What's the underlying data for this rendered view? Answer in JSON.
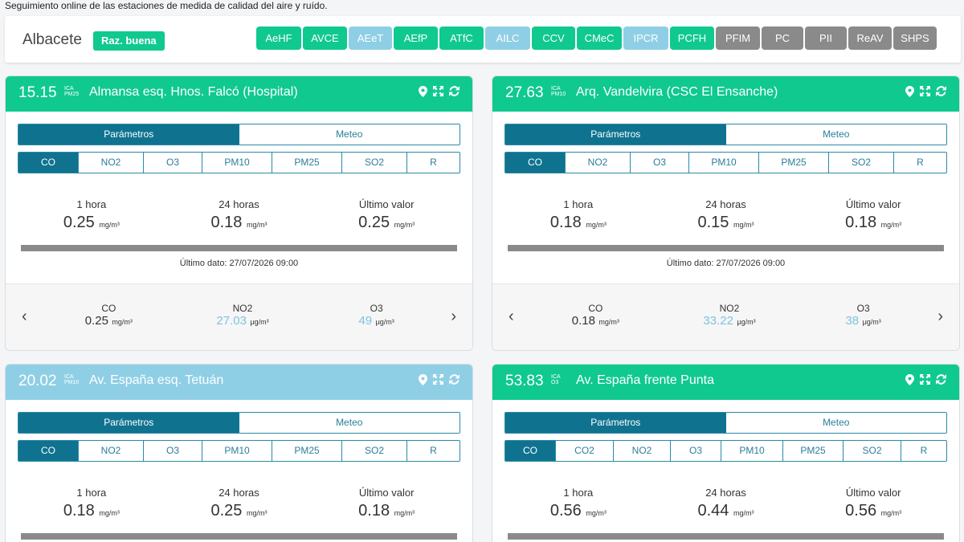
{
  "page": {
    "subtitle": "Seguimiento online de las estaciones de medida de calidad del aire y ruído."
  },
  "header": {
    "city": "Albacete",
    "city_quality": "Raz. buena",
    "stations": [
      {
        "code": "AeHF",
        "status": "good"
      },
      {
        "code": "AVCE",
        "status": "good"
      },
      {
        "code": "AEeT",
        "status": "fair"
      },
      {
        "code": "AEfP",
        "status": "good"
      },
      {
        "code": "ATfC",
        "status": "good"
      },
      {
        "code": "AILC",
        "status": "fair"
      },
      {
        "code": "CCV",
        "status": "good"
      },
      {
        "code": "CMeC",
        "status": "good"
      },
      {
        "code": "IPCR",
        "status": "fair"
      },
      {
        "code": "PCFH",
        "status": "good"
      },
      {
        "code": "PFIM",
        "status": "none"
      },
      {
        "code": "PC",
        "status": "none"
      },
      {
        "code": "PII",
        "status": "none"
      },
      {
        "code": "ReAV",
        "status": "none"
      },
      {
        "code": "SHPS",
        "status": "none"
      }
    ]
  },
  "colors": {
    "good": "#10c98f",
    "fair": "#8fcfe5",
    "none": "#8a8a8a",
    "primary": "#0f7390"
  },
  "icons": [
    "map-marker-icon",
    "expand-icon",
    "refresh-icon",
    "chevron-left-icon",
    "chevron-right-icon"
  ],
  "cards": [
    {
      "ica_value": "15.15",
      "ica_label": "ICA",
      "ica_pollutant": "PM25",
      "status": "good",
      "station_name": "Almansa esq. Hnos. Falcó (Hospital)",
      "tabs": [
        "Parámetros",
        "Meteo"
      ],
      "params": [
        "CO",
        "NO2",
        "O3",
        "PM10",
        "PM25",
        "SO2",
        "R"
      ],
      "stats": [
        {
          "label": "1 hora",
          "value": "0.25",
          "unit": "mg/m³"
        },
        {
          "label": "24 horas",
          "value": "0.18",
          "unit": "mg/m³"
        },
        {
          "label": "Último valor",
          "value": "0.25",
          "unit": "mg/m³"
        }
      ],
      "last_data": "Último dato: 27/07/2026 09:00",
      "footer": [
        {
          "label": "CO",
          "value": "0.25",
          "unit": "mg/m³",
          "hl": false
        },
        {
          "label": "NO2",
          "value": "27.03",
          "unit": "μg/m³",
          "hl": true
        },
        {
          "label": "O3",
          "value": "49",
          "unit": "μg/m³",
          "hl": true
        }
      ]
    },
    {
      "ica_value": "27.63",
      "ica_label": "ICA",
      "ica_pollutant": "PM10",
      "status": "good",
      "station_name": "Arq. Vandelvira (CSC El Ensanche)",
      "tabs": [
        "Parámetros",
        "Meteo"
      ],
      "params": [
        "CO",
        "NO2",
        "O3",
        "PM10",
        "PM25",
        "SO2",
        "R"
      ],
      "stats": [
        {
          "label": "1 hora",
          "value": "0.18",
          "unit": "mg/m³"
        },
        {
          "label": "24 horas",
          "value": "0.15",
          "unit": "mg/m³"
        },
        {
          "label": "Último valor",
          "value": "0.18",
          "unit": "mg/m³"
        }
      ],
      "last_data": "Último dato: 27/07/2026 09:00",
      "footer": [
        {
          "label": "CO",
          "value": "0.18",
          "unit": "mg/m³",
          "hl": false
        },
        {
          "label": "NO2",
          "value": "33.22",
          "unit": "μg/m³",
          "hl": true
        },
        {
          "label": "O3",
          "value": "38",
          "unit": "μg/m³",
          "hl": true
        }
      ]
    },
    {
      "ica_value": "20.02",
      "ica_label": "ICA",
      "ica_pollutant": "PM10",
      "status": "fair",
      "station_name": "Av. España esq. Tetuán",
      "tabs": [
        "Parámetros",
        "Meteo"
      ],
      "params": [
        "CO",
        "NO2",
        "O3",
        "PM10",
        "PM25",
        "SO2",
        "R"
      ],
      "stats": [
        {
          "label": "1 hora",
          "value": "0.18",
          "unit": "mg/m³"
        },
        {
          "label": "24 horas",
          "value": "0.25",
          "unit": "mg/m³"
        },
        {
          "label": "Último valor",
          "value": "0.18",
          "unit": "mg/m³"
        }
      ]
    },
    {
      "ica_value": "53.83",
      "ica_label": "ICA",
      "ica_pollutant": "O3",
      "status": "good",
      "station_name": "Av. España frente Punta",
      "tabs": [
        "Parámetros",
        "Meteo"
      ],
      "params": [
        "CO",
        "CO2",
        "NO2",
        "O3",
        "PM10",
        "PM25",
        "SO2",
        "R"
      ],
      "stats": [
        {
          "label": "1 hora",
          "value": "0.56",
          "unit": "mg/m³"
        },
        {
          "label": "24 horas",
          "value": "0.44",
          "unit": "mg/m³"
        },
        {
          "label": "Último valor",
          "value": "0.56",
          "unit": "mg/m³"
        }
      ]
    }
  ]
}
